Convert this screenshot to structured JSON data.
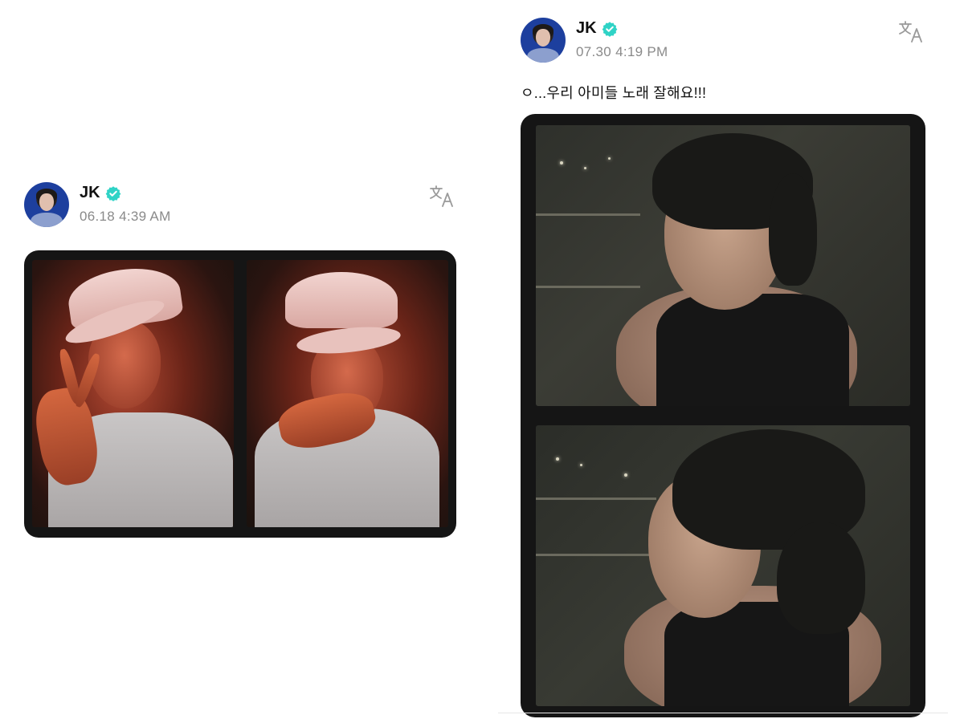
{
  "posts": [
    {
      "author": "JK",
      "timestamp": "06.18 4:39 AM",
      "text": "",
      "photos": [
        "photo-1",
        "photo-2"
      ]
    },
    {
      "author": "JK",
      "timestamp": "07.30 4:19 PM",
      "text": "ㅇ...우리 아미들 노래 잘해요!!!",
      "photos": [
        "photo-1",
        "photo-2"
      ]
    }
  ],
  "icons": {
    "verified": "verified-badge-icon",
    "translate": "translate-icon"
  },
  "colors": {
    "verified": "#2fd3c6",
    "timestamp": "#8a8a8a",
    "frame": "#151515"
  }
}
